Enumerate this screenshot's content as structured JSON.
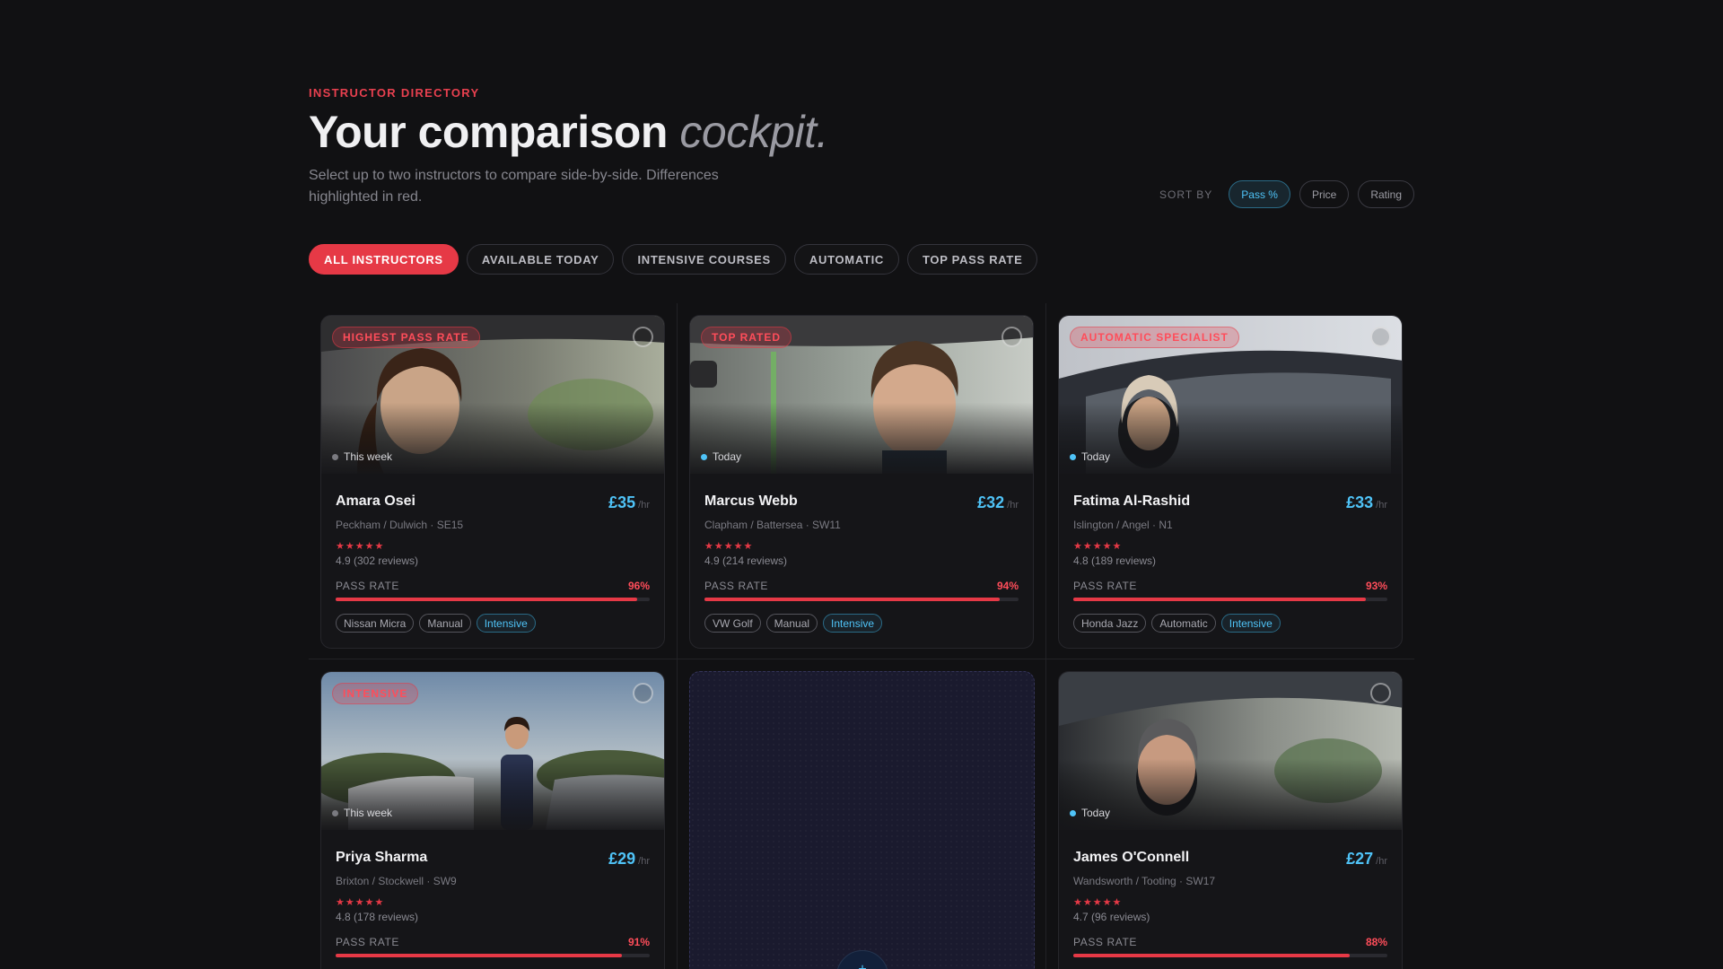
{
  "header": {
    "eyebrow": "INSTRUCTOR DIRECTORY",
    "title_main": "Your comparison",
    "title_accent": "cockpit.",
    "subtitle": "Select up to two instructors to compare side-by-side. Differences highlighted in red."
  },
  "sort": {
    "label": "SORT BY",
    "options": [
      "Pass %",
      "Price",
      "Rating"
    ],
    "active": "Pass %"
  },
  "filters": {
    "options": [
      "ALL INSTRUCTORS",
      "AVAILABLE TODAY",
      "INTENSIVE COURSES",
      "AUTOMATIC",
      "TOP PASS RATE"
    ],
    "active": "ALL INSTRUCTORS"
  },
  "labels": {
    "pass_rate": "PASS RATE",
    "per_hour": "/hr"
  },
  "instructors": [
    {
      "badge": "HIGHEST PASS RATE",
      "availability": "This week",
      "available_today": false,
      "name": "Amara Osei",
      "price": "£35",
      "area": "Peckham / Dulwich · SE15",
      "stars": "★★★★★",
      "reviews": "4.9 (302 reviews)",
      "pass_rate": "96%",
      "pass_rate_value": 96,
      "tags": [
        "Nissan Micra",
        "Manual",
        "Intensive"
      ]
    },
    {
      "badge": "TOP RATED",
      "availability": "Today",
      "available_today": true,
      "name": "Marcus Webb",
      "price": "£32",
      "area": "Clapham / Battersea · SW11",
      "stars": "★★★★★",
      "reviews": "4.9 (214 reviews)",
      "pass_rate": "94%",
      "pass_rate_value": 94,
      "tags": [
        "VW Golf",
        "Manual",
        "Intensive"
      ]
    },
    {
      "badge": "AUTOMATIC SPECIALIST",
      "availability": "Today",
      "available_today": true,
      "name": "Fatima Al-Rashid",
      "price": "£33",
      "area": "Islington / Angel · N1",
      "stars": "★★★★★",
      "reviews": "4.8 (189 reviews)",
      "pass_rate": "93%",
      "pass_rate_value": 93,
      "tags": [
        "Honda Jazz",
        "Automatic",
        "Intensive"
      ]
    },
    {
      "badge": "INTENSIVE",
      "availability": "This week",
      "available_today": false,
      "name": "Priya Sharma",
      "price": "£29",
      "area": "Brixton / Stockwell · SW9",
      "stars": "★★★★★",
      "reviews": "4.8 (178 reviews)",
      "pass_rate": "91%",
      "pass_rate_value": 91,
      "tags": []
    },
    {
      "badge": "",
      "availability": "Today",
      "available_today": true,
      "name": "James O'Connell",
      "price": "£27",
      "area": "Wandsworth / Tooting · SW17",
      "stars": "★★★★★",
      "reviews": "4.7 (96 reviews)",
      "pass_rate": "88%",
      "pass_rate_value": 88,
      "tags": []
    }
  ],
  "empty_slot": {
    "icon": "plus-icon",
    "symbol": "+"
  },
  "colors": {
    "accent_red": "#e63946",
    "accent_blue": "#4fc3f7",
    "background": "#111113"
  }
}
